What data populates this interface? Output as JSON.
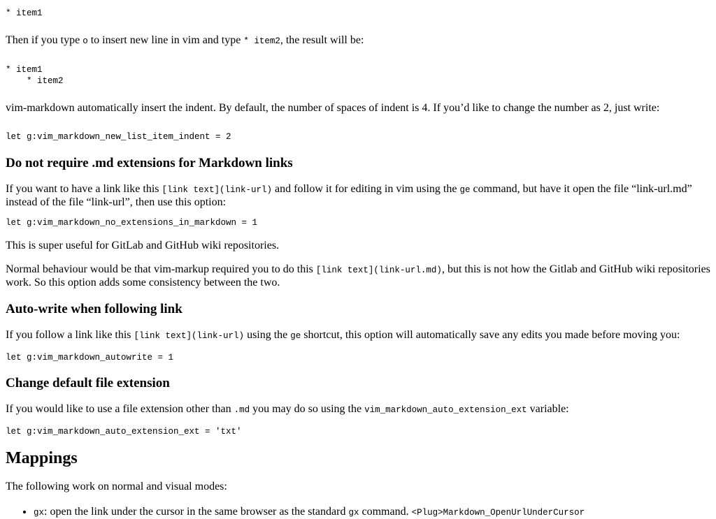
{
  "code_item1": "* item1",
  "p_type": {
    "t1": "Then if you type ",
    "c1": "o",
    "t2": " to insert new line in vim and type ",
    "c2": "* item2",
    "t3": ", the result will be:"
  },
  "code_items": "* item1\n    * item2",
  "p_indent": "vim-markdown automatically insert the indent. By default, the number of spaces of indent is 4. If you’d like to change the number as 2, just write:",
  "code_indent": "let g:vim_markdown_new_list_item_indent = 2",
  "h_no_ext": "Do not require .md extensions for Markdown links",
  "p_link": {
    "t1": "If you want to have a link like this ",
    "c1": "[link text](link-url)",
    "t2": " and follow it for editing in vim using the ",
    "c2": "ge",
    "t3": " command, but have it open the file “link-url.md” instead of the file “link-url”, then use this option:"
  },
  "code_no_ext": "let g:vim_markdown_no_extensions_in_markdown = 1",
  "p_useful": "This is super useful for GitLab and GitHub wiki repositories.",
  "p_normal": {
    "t1": "Normal behaviour would be that vim-markup required you to do this ",
    "c1": "[link text](link-url.md)",
    "t2": ", but this is not how the Gitlab and GitHub wiki repositories work. So this option adds some consistency between the two."
  },
  "h_autowrite": "Auto-write when following link",
  "p_follow": {
    "t1": "If you follow a link like this ",
    "c1": "[link text](link-url)",
    "t2": " using the ",
    "c2": "ge",
    "t3": " shortcut, this option will automatically save any edits you made before moving you:"
  },
  "code_autowrite": "let g:vim_markdown_autowrite = 1",
  "h_ext": "Change default file extension",
  "p_ext": {
    "t1": "If you would like to use a file extension other than ",
    "c1": ".md",
    "t2": " you may do so using the ",
    "c2": "vim_markdown_auto_extension_ext",
    "t3": " variable:"
  },
  "code_ext": "let g:vim_markdown_auto_extension_ext = 'txt'",
  "h_mappings": "Mappings",
  "p_modes": "The following work on normal and visual modes:",
  "mapping_items": [
    {
      "key": "gx",
      "t1": ": open the link under the cursor in the same browser as the standard ",
      "c1": "gx",
      "t2": " command. ",
      "c2": "<Plug>Markdown_OpenUrlUnderCursor"
    }
  ]
}
